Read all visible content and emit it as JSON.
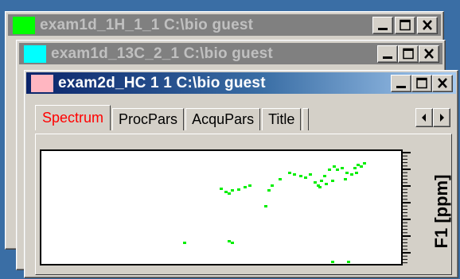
{
  "windows": [
    {
      "id": "win1",
      "title": "exam1d_1H_1_1 C:\\bio guest",
      "swatch_color": "#00ff00",
      "active": false
    },
    {
      "id": "win2",
      "title": "exam1d_13C_2_1 C:\\bio guest",
      "swatch_color": "#00ffff",
      "active": false
    },
    {
      "id": "win3",
      "title": "exam2d_HC 1 1 C:\\bio guest",
      "swatch_color": "#ffb6c1",
      "active": true
    }
  ],
  "tabs": [
    "Spectrum",
    "ProcPars",
    "AcquPars",
    "Title"
  ],
  "selected_tab": "Spectrum",
  "colors": {
    "peak": "#00ee00",
    "selected_tab_text": "#ff0000",
    "desktop": "#3a6ea5"
  },
  "icons": [
    "minimize-icon",
    "maximize-icon",
    "close-icon",
    "scroll-left-icon",
    "scroll-right-icon"
  ],
  "chart_data": {
    "type": "scatter",
    "ylabel": "F1 [ppm]",
    "xlabel": "",
    "title": ""
  }
}
